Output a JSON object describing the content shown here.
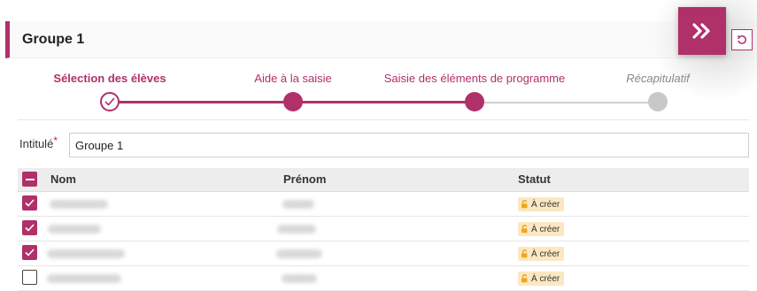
{
  "header": {
    "title": "Groupe 1"
  },
  "stepper": {
    "steps": [
      {
        "label": "Sélection des élèves",
        "state": "done"
      },
      {
        "label": "Aide à la saisie",
        "state": "filled"
      },
      {
        "label": "Saisie des éléments de programme",
        "state": "filled"
      },
      {
        "label": "Récapitulatif",
        "state": "pending"
      }
    ]
  },
  "form": {
    "intitule_label": "Intitulé",
    "required_mark": "*",
    "intitule_value": "Groupe 1"
  },
  "table": {
    "columns": [
      "Nom",
      "Prénom",
      "Statut"
    ],
    "rows": [
      {
        "checked": true,
        "status": "À créer"
      },
      {
        "checked": true,
        "status": "À créer"
      },
      {
        "checked": true,
        "status": "À créer"
      },
      {
        "checked": false,
        "status": "À créer"
      }
    ]
  },
  "icons": {
    "next": "double-chevron-right-icon",
    "reset": "undo-icon",
    "status": "unlock-icon"
  },
  "colors": {
    "accent": "#b0306a",
    "badge_bg": "#fbe8c2",
    "pending": "#c8c8c8"
  }
}
